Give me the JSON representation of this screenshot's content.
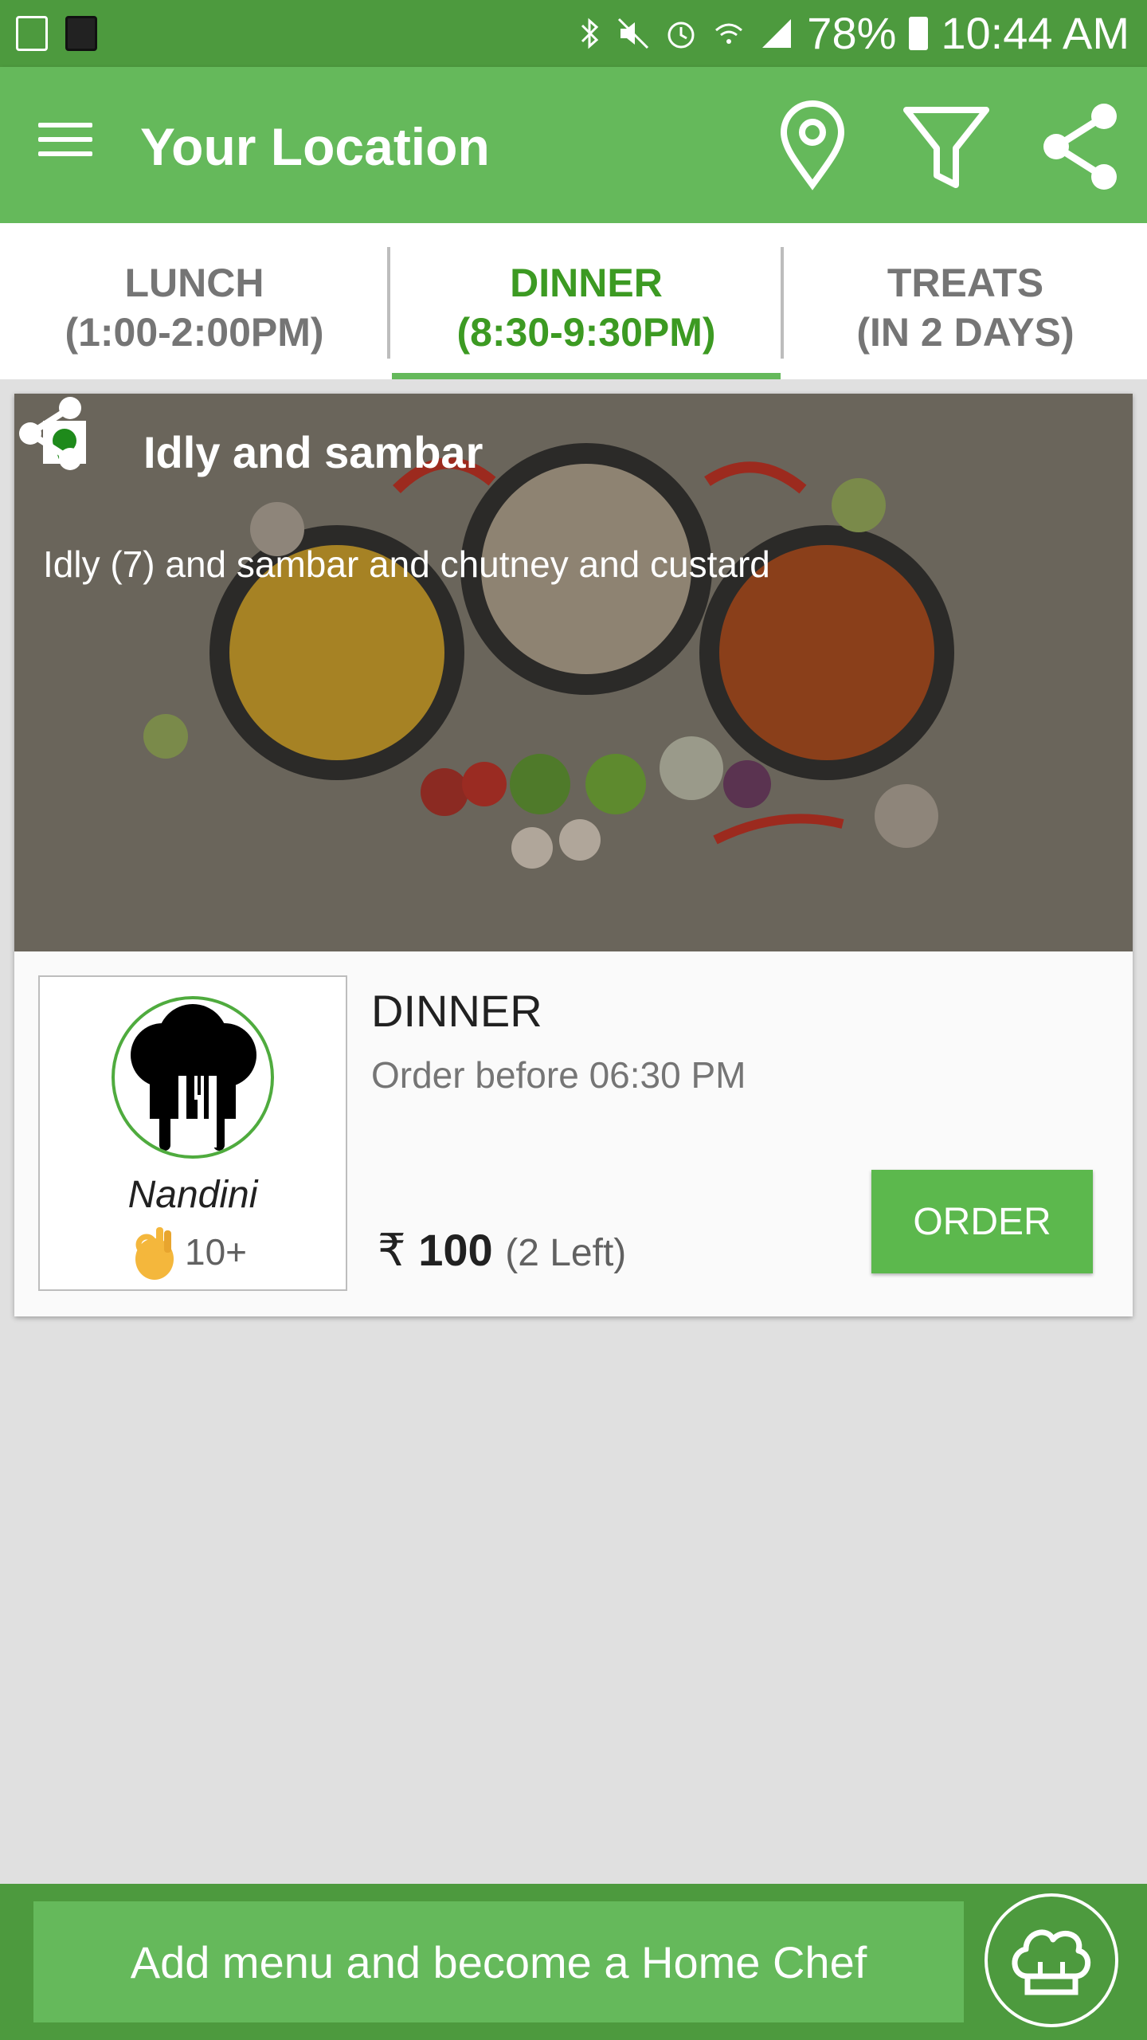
{
  "status_bar": {
    "battery": "78%",
    "time": "10:44 AM"
  },
  "app_bar": {
    "title": "Your Location",
    "icons": [
      "menu-icon",
      "location-pin-icon",
      "filter-icon",
      "share-icon"
    ]
  },
  "tabs": [
    {
      "label_line1": "LUNCH",
      "label_line2": "(1:00-2:00PM)",
      "active": false
    },
    {
      "label_line1": "DINNER",
      "label_line2": "(8:30-9:30PM)",
      "active": true
    },
    {
      "label_line1": "TREATS",
      "label_line2": "(IN 2 DAYS)",
      "active": false
    }
  ],
  "card": {
    "veg_label": "VEG",
    "dish_title": "Idly and sambar",
    "dish_description": "Idly (7) and sambar and chutney and  custard",
    "chef_name": "Nandini",
    "rating_count": "10+",
    "meal_type": "DINNER",
    "order_before": "Order before 06:30 PM",
    "currency": "₹",
    "price": "100",
    "remaining": "(2 Left)",
    "order_label": "ORDER"
  },
  "bottom": {
    "add_menu_label": "Add menu and become a Home Chef"
  },
  "colors": {
    "primary": "#65b95b",
    "primary_dark": "#4d9a3e",
    "active_tab": "#3c9a22"
  }
}
